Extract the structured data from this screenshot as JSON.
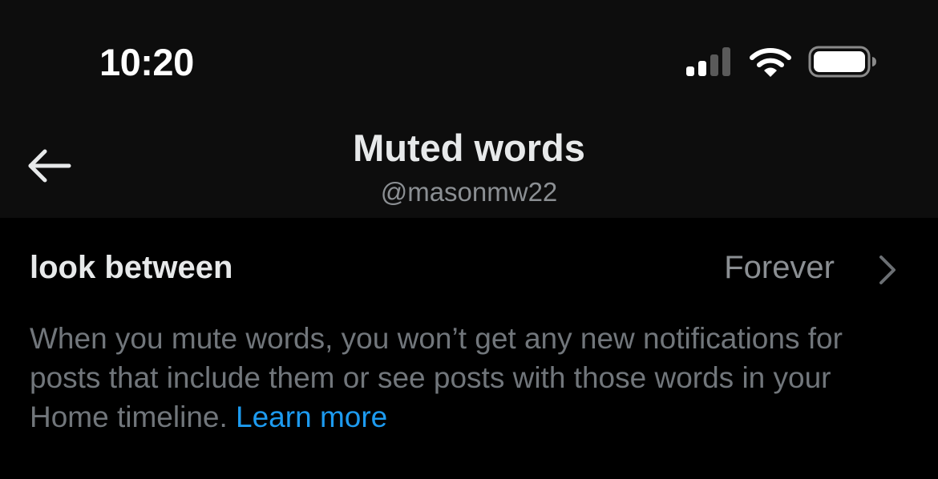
{
  "status_bar": {
    "time": "10:20",
    "signal_icon": "cellular-signal-icon",
    "wifi_icon": "wifi-icon",
    "battery_icon": "battery-icon",
    "signal_bars_active": 2,
    "signal_bars_total": 4
  },
  "header": {
    "back_icon": "arrow-left-icon",
    "title": "Muted words",
    "subtitle": "@masonmw22"
  },
  "muted_item": {
    "label": "look between",
    "duration": "Forever",
    "chevron_icon": "chevron-right-icon"
  },
  "description": {
    "text": "When you mute words, you won’t get any new notifications for posts that include them or see posts with those words in your Home timeline. ",
    "link_label": "Learn more"
  },
  "colors": {
    "background": "#000000",
    "header_background": "#0d0d0d",
    "primary_text": "#e7e9ea",
    "secondary_text": "#8b8f93",
    "link": "#1d9bf0"
  }
}
